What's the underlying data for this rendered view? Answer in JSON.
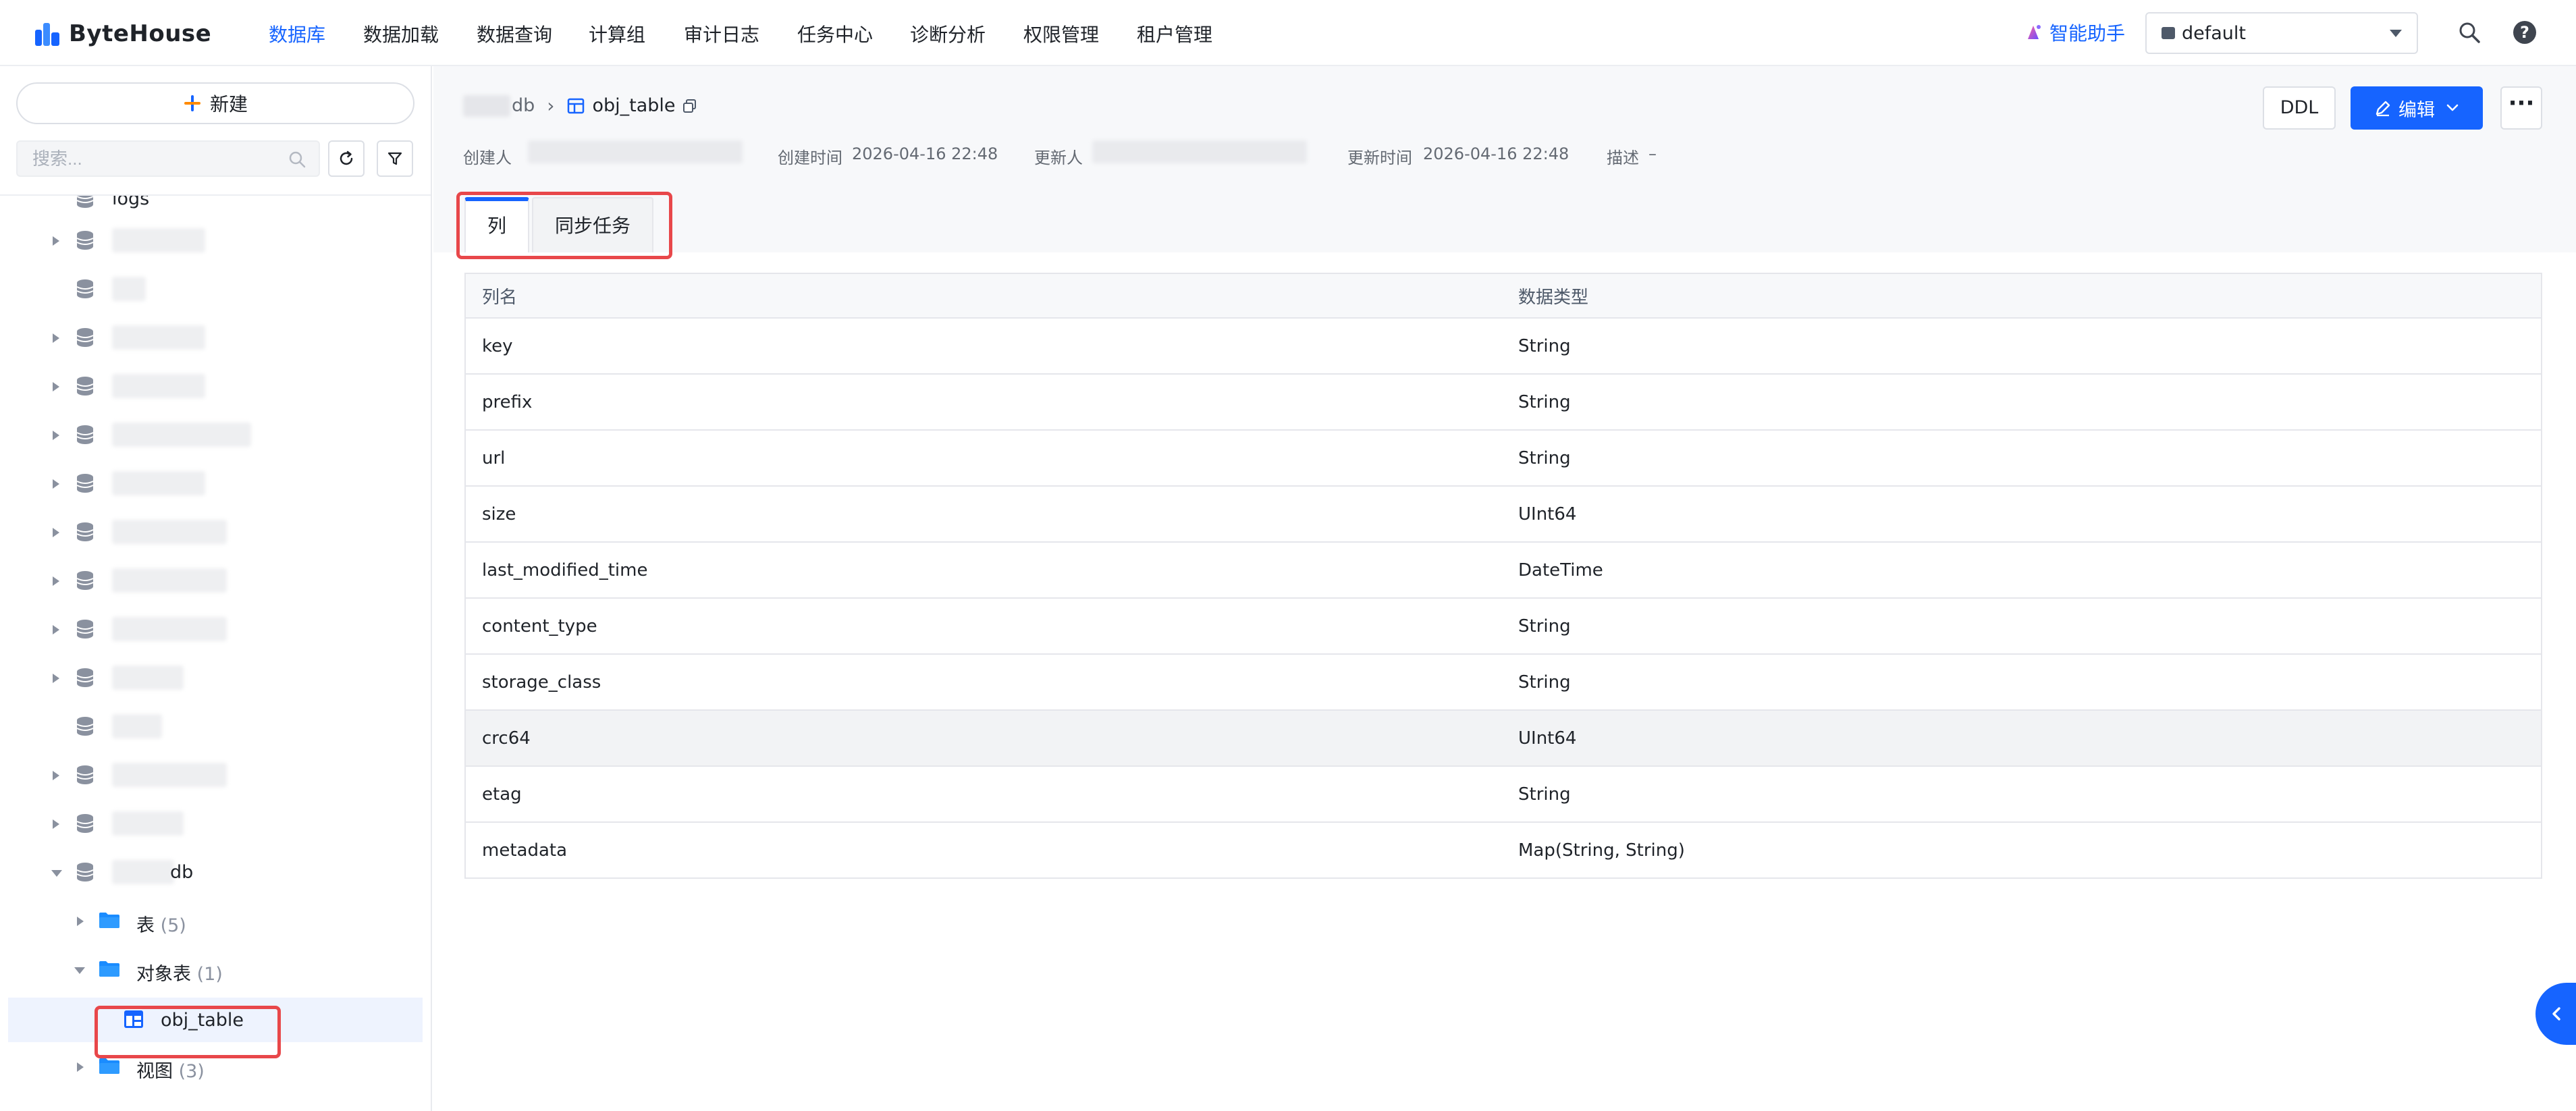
{
  "app": {
    "name": "ByteHouse"
  },
  "nav": {
    "items": [
      "数据库",
      "数据加载",
      "数据查询",
      "计算组",
      "审计日志",
      "任务中心",
      "诊断分析",
      "权限管理",
      "租户管理"
    ],
    "active": "数据库",
    "assistant_label": "智能助手",
    "tenant_selected": "default"
  },
  "sidebar": {
    "new_label": "新建",
    "search_placeholder": "搜索...",
    "partial_top_label": "logs",
    "expanded_db_label": "db",
    "children": [
      {
        "label": "表",
        "count": "(5)"
      },
      {
        "label": "对象表",
        "count": "(1)"
      },
      {
        "label": "obj_table",
        "count": ""
      },
      {
        "label": "视图",
        "count": "(3)"
      }
    ]
  },
  "breadcrumb": {
    "db": "db",
    "table": "obj_table"
  },
  "meta": {
    "creator_label": "创建人",
    "created_time_label": "创建时间",
    "created_time": "2026-04-16 22:48",
    "updater_label": "更新人",
    "updated_time_label": "更新时间",
    "updated_time": "2026-04-16 22:48",
    "desc_label": "描述",
    "desc_value": "–"
  },
  "actions": {
    "ddl": "DDL",
    "edit": "编辑",
    "more": "···"
  },
  "tabs": [
    {
      "label": "列",
      "active": true
    },
    {
      "label": "同步任务",
      "active": false
    }
  ],
  "table": {
    "headers": [
      "列名",
      "数据类型"
    ],
    "rows": [
      [
        "key",
        "String"
      ],
      [
        "prefix",
        "String"
      ],
      [
        "url",
        "String"
      ],
      [
        "size",
        "UInt64"
      ],
      [
        "last_modified_time",
        "DateTime"
      ],
      [
        "content_type",
        "String"
      ],
      [
        "storage_class",
        "String"
      ],
      [
        "crc64",
        "UInt64"
      ],
      [
        "etag",
        "String"
      ],
      [
        "metadata",
        "Map(String, String)"
      ]
    ]
  },
  "colors": {
    "accent": "#1664ff",
    "highlight": "#e8474a"
  }
}
